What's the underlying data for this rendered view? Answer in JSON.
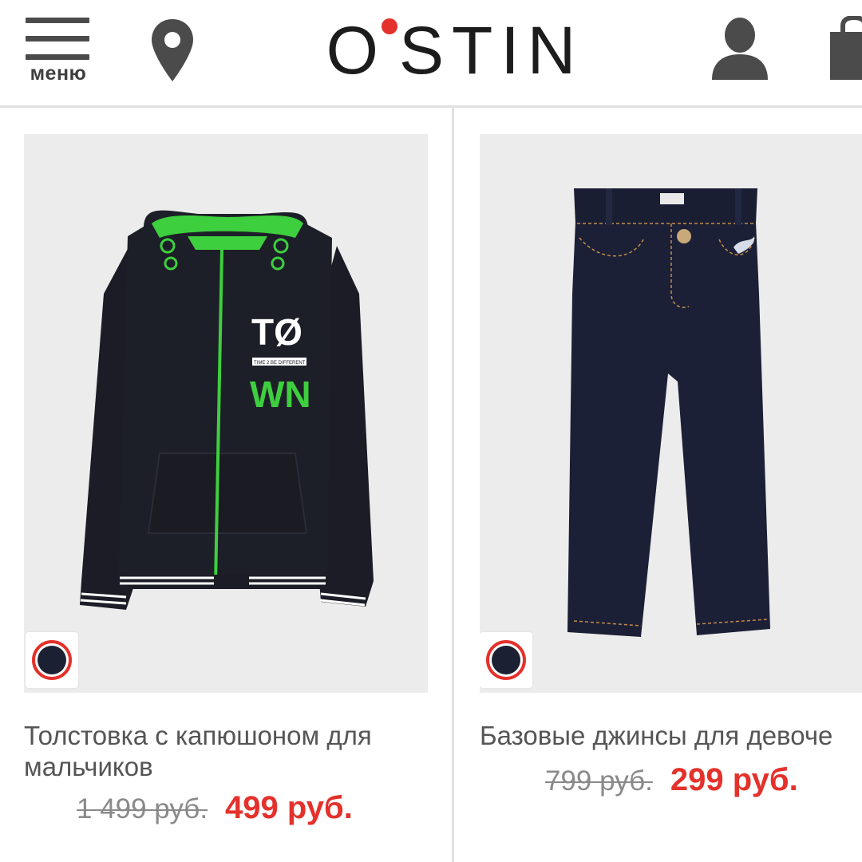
{
  "header": {
    "menu_label": "меню",
    "logo": "O°STIN",
    "logo_left": "O",
    "logo_right": "STIN",
    "icons": [
      "menu-icon",
      "location-pin-icon",
      "account-icon",
      "shopping-bag-icon"
    ]
  },
  "colors": {
    "accent": "#e4312b",
    "text": "#555555",
    "old_price": "#8a8a8a",
    "image_bg": "#ececec"
  },
  "products": [
    {
      "title": "Толстовка с капюшоном для мальчиков",
      "old_price": "1 499 руб.",
      "new_price": "499 руб.",
      "swatch_color": "#1b2133"
    },
    {
      "title": "Базовые джинсы для девоче",
      "old_price": "799 руб.",
      "new_price": "299 руб.",
      "swatch_color": "#1b2133"
    }
  ],
  "hoodie_print": {
    "line1": "TØ",
    "line2": "WN",
    "tagline": "TIME 2 BE DIFFERENT"
  }
}
